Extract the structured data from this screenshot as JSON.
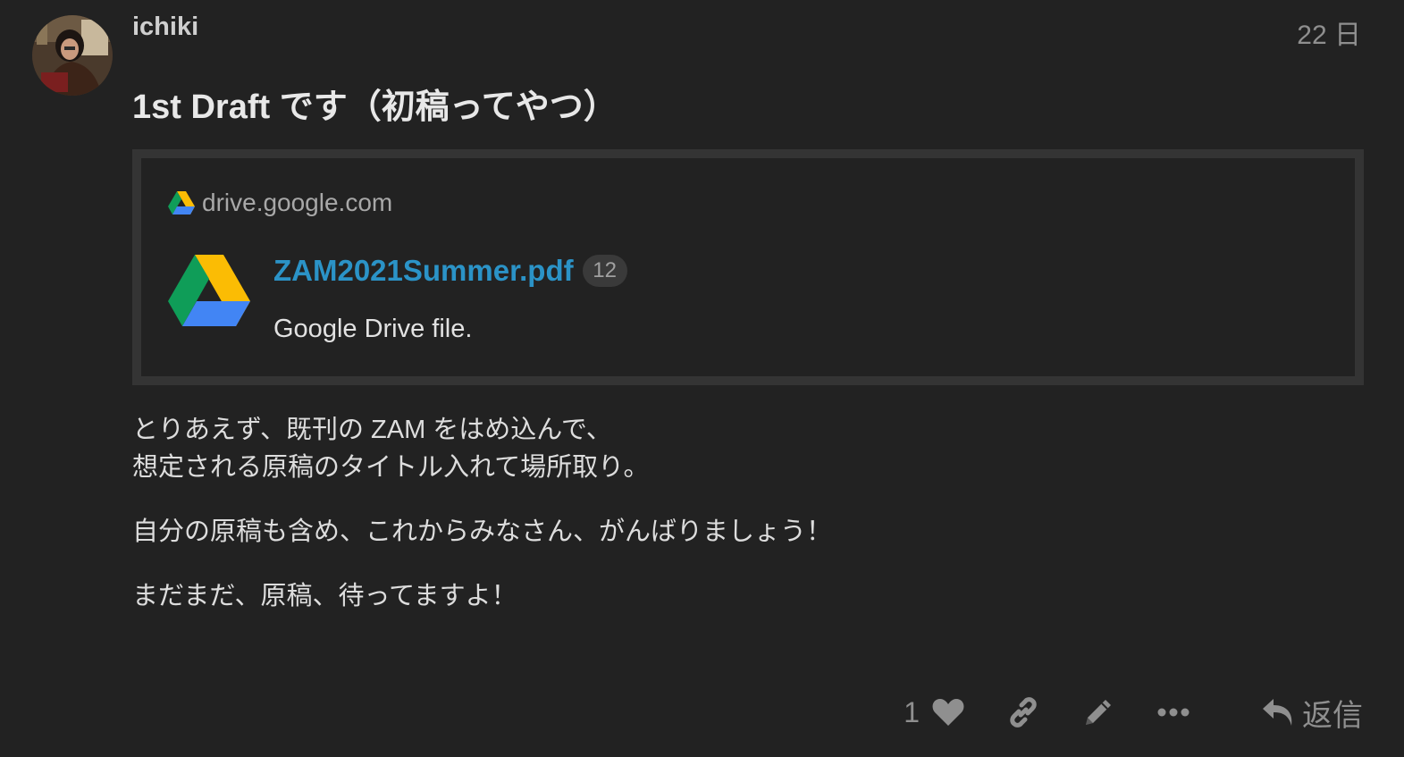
{
  "post": {
    "username": "ichiki",
    "date": "22 日",
    "title": "1st Draft です（初稿ってやつ）"
  },
  "onebox": {
    "source": "drive.google.com",
    "filename": "ZAM2021Summer.pdf",
    "click_count": "12",
    "description": "Google Drive file."
  },
  "body": {
    "line1": "とりあえず、既刊の ZAM をはめ込んで、",
    "line2": "想定される原稿のタイトル入れて場所取り。",
    "para2": "自分の原稿も含め、これからみなさん、がんばりましょう！",
    "para3": "まだまだ、原稿、待ってますよ！"
  },
  "actions": {
    "like_count": "1",
    "reply_label": "返信"
  },
  "icons": {
    "like": "heart-icon",
    "link": "link-icon",
    "edit": "pencil-icon",
    "more": "ellipsis-icon",
    "reply": "reply-arrow-icon",
    "source": "google-drive-icon"
  },
  "colors": {
    "background": "#222222",
    "link": "#2b93c7",
    "muted": "#8f8f8f",
    "onebox_border": "#343434"
  }
}
